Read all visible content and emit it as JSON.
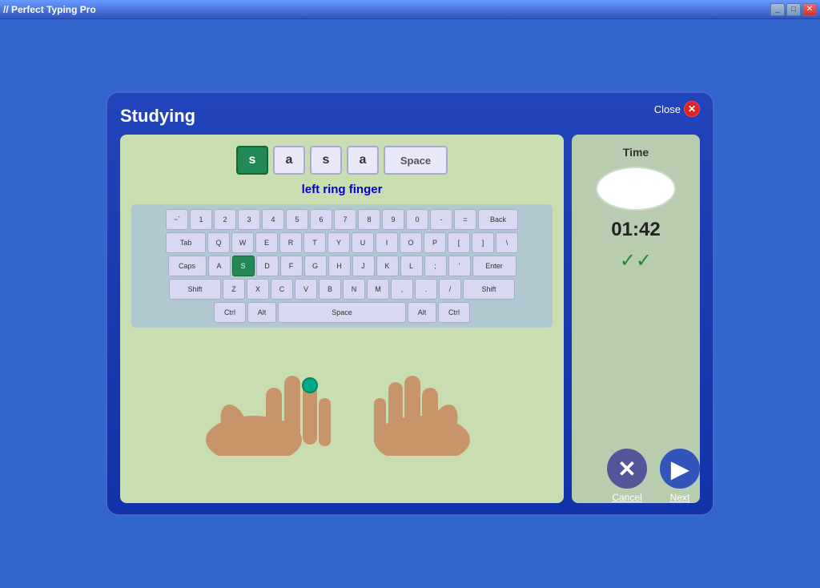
{
  "app": {
    "title": "// Perfect Typing Pro",
    "taskbar_buttons": [
      "_",
      "□",
      "✕"
    ]
  },
  "dialog": {
    "title": "Studying",
    "close_label": "Close"
  },
  "key_sequence": [
    {
      "label": "s",
      "active": true
    },
    {
      "label": "a",
      "active": false
    },
    {
      "label": "s",
      "active": false
    },
    {
      "label": "a",
      "active": false
    },
    {
      "label": "Space",
      "active": false,
      "wide": true
    }
  ],
  "finger_label": "left ring finger",
  "keyboard": {
    "rows": [
      [
        {
          "label": "`\n~",
          "w": 1
        },
        {
          "label": "1\n!",
          "w": 1
        },
        {
          "label": "2\n@",
          "w": 1
        },
        {
          "label": "3\n#",
          "w": 1
        },
        {
          "label": "4\n$",
          "w": 1
        },
        {
          "label": "5\n%",
          "w": 1
        },
        {
          "label": "6\n^",
          "w": 1
        },
        {
          "label": "7\n&",
          "w": 1
        },
        {
          "label": "8\n*",
          "w": 1
        },
        {
          "label": "9\n(",
          "w": 1
        },
        {
          "label": "0\n)",
          "w": 1
        },
        {
          "label": "-\n_",
          "w": 1
        },
        {
          "label": "=\n+",
          "w": 1
        },
        {
          "label": "Back",
          "w": 2
        }
      ],
      [
        {
          "label": "Tab",
          "w": 2
        },
        {
          "label": "Q",
          "w": 1
        },
        {
          "label": "W",
          "w": 1
        },
        {
          "label": "E",
          "w": 1
        },
        {
          "label": "R",
          "w": 1
        },
        {
          "label": "T",
          "w": 1
        },
        {
          "label": "Y",
          "w": 1
        },
        {
          "label": "U",
          "w": 1
        },
        {
          "label": "I",
          "w": 1
        },
        {
          "label": "O",
          "w": 1
        },
        {
          "label": "P",
          "w": 1
        },
        {
          "label": "{\n[",
          "w": 1
        },
        {
          "label": "}\n]",
          "w": 1
        },
        {
          "label": "|\n\\",
          "w": 1
        }
      ],
      [
        {
          "label": "Caps",
          "w": 2
        },
        {
          "label": "A",
          "w": 1
        },
        {
          "label": "S",
          "w": 1,
          "highlight": true
        },
        {
          "label": "D",
          "w": 1
        },
        {
          "label": "F",
          "w": 1
        },
        {
          "label": "G",
          "w": 1
        },
        {
          "label": "H",
          "w": 1
        },
        {
          "label": "J",
          "w": 1
        },
        {
          "label": "K",
          "w": 1
        },
        {
          "label": "L",
          "w": 1
        },
        {
          "label": ":\n;",
          "w": 1
        },
        {
          "label": "\"\n'",
          "w": 1
        },
        {
          "label": "Enter",
          "w": 2
        }
      ],
      [
        {
          "label": "Shift",
          "w": 3
        },
        {
          "label": "Z",
          "w": 1
        },
        {
          "label": "X",
          "w": 1
        },
        {
          "label": "C",
          "w": 1
        },
        {
          "label": "V",
          "w": 1
        },
        {
          "label": "B",
          "w": 1
        },
        {
          "label": "N",
          "w": 1
        },
        {
          "label": "M",
          "w": 1
        },
        {
          "label": "<\n,",
          "w": 1
        },
        {
          "label": ">\n.",
          "w": 1
        },
        {
          "label": "?\n/",
          "w": 1
        },
        {
          "label": "Shift",
          "w": 3
        }
      ],
      [
        {
          "label": "Ctrl",
          "w": 2
        },
        {
          "label": "Alt",
          "w": 1.5
        },
        {
          "label": "Space",
          "w": 6
        },
        {
          "label": "Alt",
          "w": 1.5
        },
        {
          "label": "Ctrl",
          "w": 2
        }
      ]
    ]
  },
  "time": {
    "label": "Time",
    "value": "01:42"
  },
  "checks": "✓✓",
  "buttons": {
    "cancel": "Cancel",
    "next": "Next"
  }
}
